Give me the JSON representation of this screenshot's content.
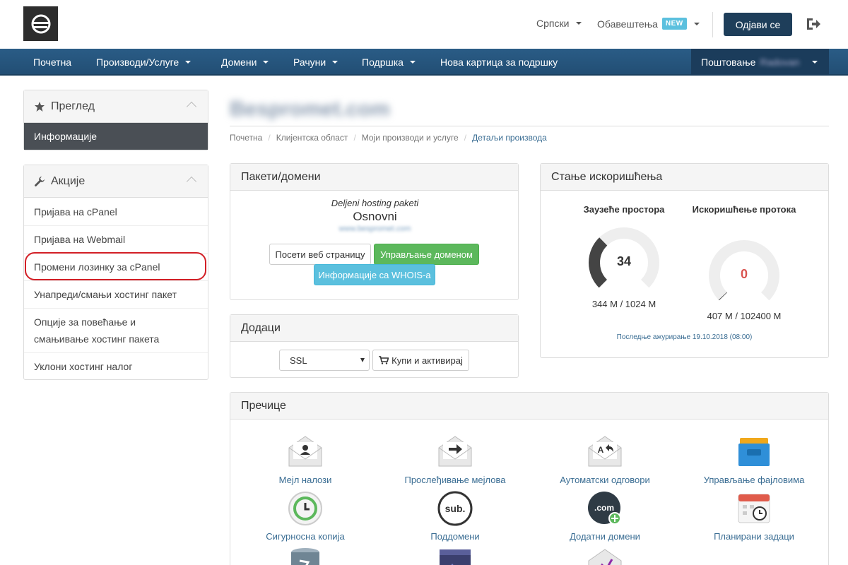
{
  "header": {
    "language": "Српски",
    "notifications": "Обавештења",
    "notifications_badge": "NEW",
    "logout_label": "Одјави се"
  },
  "nav": {
    "items": [
      {
        "label": "Почетна"
      },
      {
        "label": "Производи/Услуге"
      },
      {
        "label": "Домени"
      },
      {
        "label": "Рачуни"
      },
      {
        "label": "Подршка"
      },
      {
        "label": "Нова картица за подршку"
      }
    ],
    "greeting": "Поштовање",
    "user_name": "Radovan"
  },
  "sidebar": {
    "overview": {
      "title": "Преглед",
      "items": [
        {
          "label": "Информације"
        }
      ]
    },
    "actions": {
      "title": "Акције",
      "items": [
        {
          "label": "Пријава на cPanel"
        },
        {
          "label": "Пријава на Webmail"
        },
        {
          "label": "Промени лозинку за cPanel"
        },
        {
          "label": "Унапреди/смањи хостинг пакет"
        },
        {
          "label": "Опције за повећање и смањивање хостинг пакета"
        },
        {
          "label": "Уклони хостинг налог"
        }
      ]
    }
  },
  "main": {
    "page_title": "Bespromet.com",
    "breadcrumb": [
      "Почетна",
      "Клијентска област",
      "Моји производи и услуге",
      "Детаљи производа"
    ],
    "packages": {
      "title": "Пакети/домени",
      "category": "Deljeni hosting paketi",
      "plan": "Osnovni",
      "domain": "www.bespromet.com",
      "visit_button": "Посети веб страницу",
      "manage_domain_button": "Управљање доменом",
      "whois_button": "Информације са WHOIS-a"
    },
    "addons": {
      "title": "Додаци",
      "selected": "SSL",
      "buy_button": "Купи и активирај"
    },
    "usage": {
      "title": "Стање искоришћења",
      "disk": {
        "title": "Заузеће простора",
        "value": "34",
        "text": "344 M / 1024 M",
        "fraction": 0.336
      },
      "bandwidth": {
        "title": "Искоришћење протока",
        "value": "0",
        "text": "407 M / 102400 M",
        "fraction": 0.004
      },
      "last_updated": "Последње ажурирање 19.10.2018 (08:00)"
    },
    "shortcuts": {
      "title": "Пречице",
      "items": [
        {
          "label": "Мејл налози",
          "icon": "mail-accounts-icon"
        },
        {
          "label": "Прослеђивање мејлова",
          "icon": "mail-forward-icon"
        },
        {
          "label": "Аутоматски одговори",
          "icon": "autoresponder-icon"
        },
        {
          "label": "Управљање фајловима",
          "icon": "file-manager-icon"
        },
        {
          "label": "Сигурносна копија",
          "icon": "backup-icon"
        },
        {
          "label": "Поддомени",
          "icon": "subdomain-icon"
        },
        {
          "label": "Додатни домени",
          "icon": "addon-domain-icon"
        },
        {
          "label": "Планирани задаци",
          "icon": "cron-jobs-icon"
        }
      ]
    }
  }
}
